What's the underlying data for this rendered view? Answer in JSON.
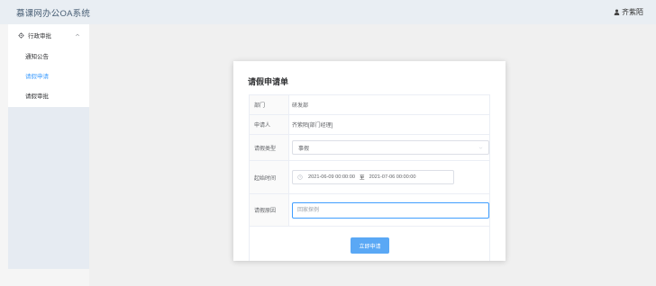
{
  "header": {
    "app_title": "慕课网办公OA系统",
    "user_name": "齐紫陌",
    "user_icon": "user-icon"
  },
  "sidebar": {
    "group": {
      "label": "行政审批",
      "icon": "gear-icon",
      "chevron": "chevron-up-icon"
    },
    "items": [
      {
        "label": "通知公告"
      },
      {
        "label": "请假申请"
      },
      {
        "label": "请假审批"
      }
    ],
    "active_color": "#409eff"
  },
  "dialog": {
    "title": "请假申请单",
    "fields": {
      "department": {
        "label": "部门",
        "value": "研发部"
      },
      "applicant": {
        "label": "申请人",
        "value": "齐紫陌[部门经理]"
      },
      "leave_type": {
        "label": "请假类型",
        "value": "事假"
      },
      "time_range": {
        "label": "起始时间",
        "start": "2021-06-09 00:00:00",
        "separator": "至",
        "end": "2021-07-06 00:00:00"
      },
      "reason": {
        "label": "请假原因",
        "placeholder": "回家探例"
      }
    },
    "submit_label": "立即申请"
  }
}
